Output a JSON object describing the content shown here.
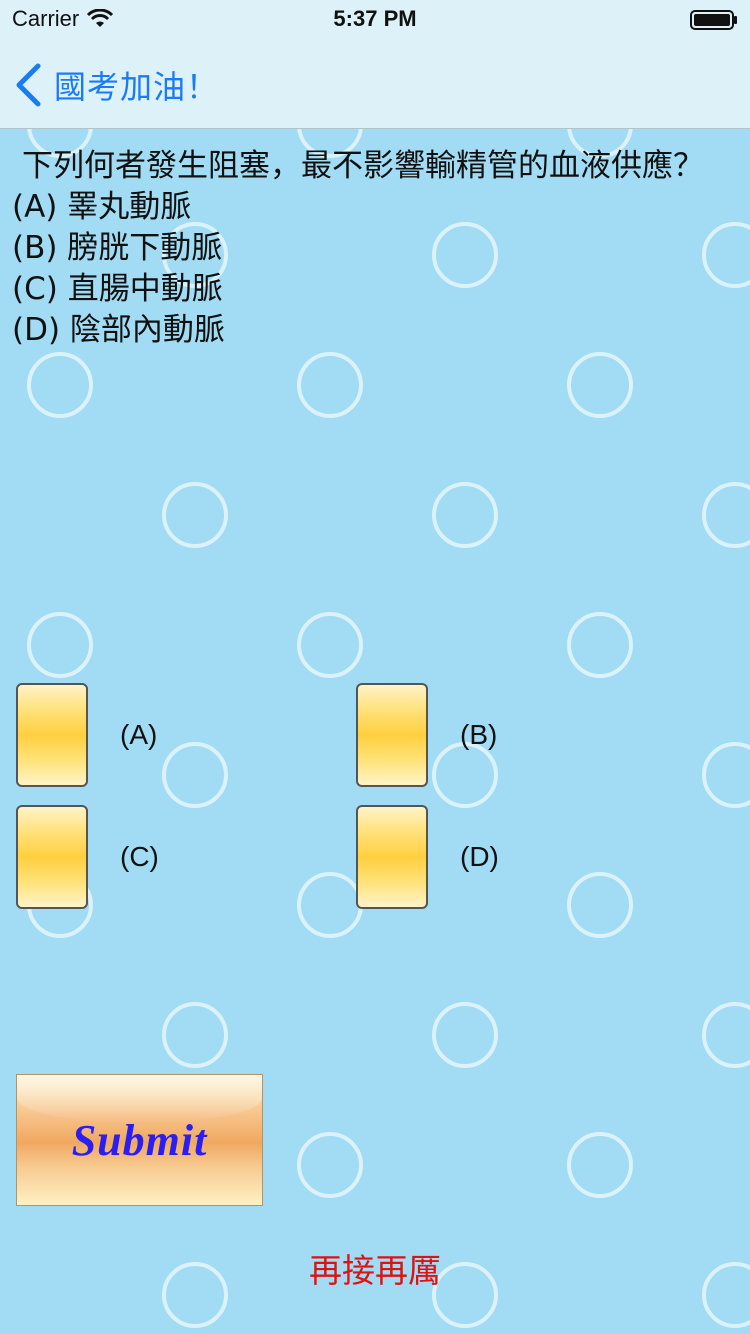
{
  "status_bar": {
    "carrier": "Carrier",
    "time": "5:37 PM",
    "wifi_icon": "wifi-icon",
    "battery_icon": "battery-icon"
  },
  "nav": {
    "back_icon": "chevron-left-icon",
    "back_label": "國考加油！"
  },
  "question": {
    "text": "下列何者發生阻塞，最不影響輸精管的血液供應？",
    "options": [
      "(A) 睪丸動脈",
      "(B) 膀胱下動脈",
      "(C) 直腸中動脈",
      "(D) 陰部內動脈"
    ]
  },
  "choices": [
    {
      "label": "(A)"
    },
    {
      "label": "(B)"
    },
    {
      "label": "(C)"
    },
    {
      "label": "(D)"
    }
  ],
  "submit": {
    "label": "Submit"
  },
  "feedback": {
    "text": "再接再厲"
  },
  "colors": {
    "background": "#a1dcf4",
    "bars": "#ddf1f9",
    "accent": "#1a7cf5",
    "feedback": "#e1110f",
    "submit_text": "#2a1ef2"
  }
}
